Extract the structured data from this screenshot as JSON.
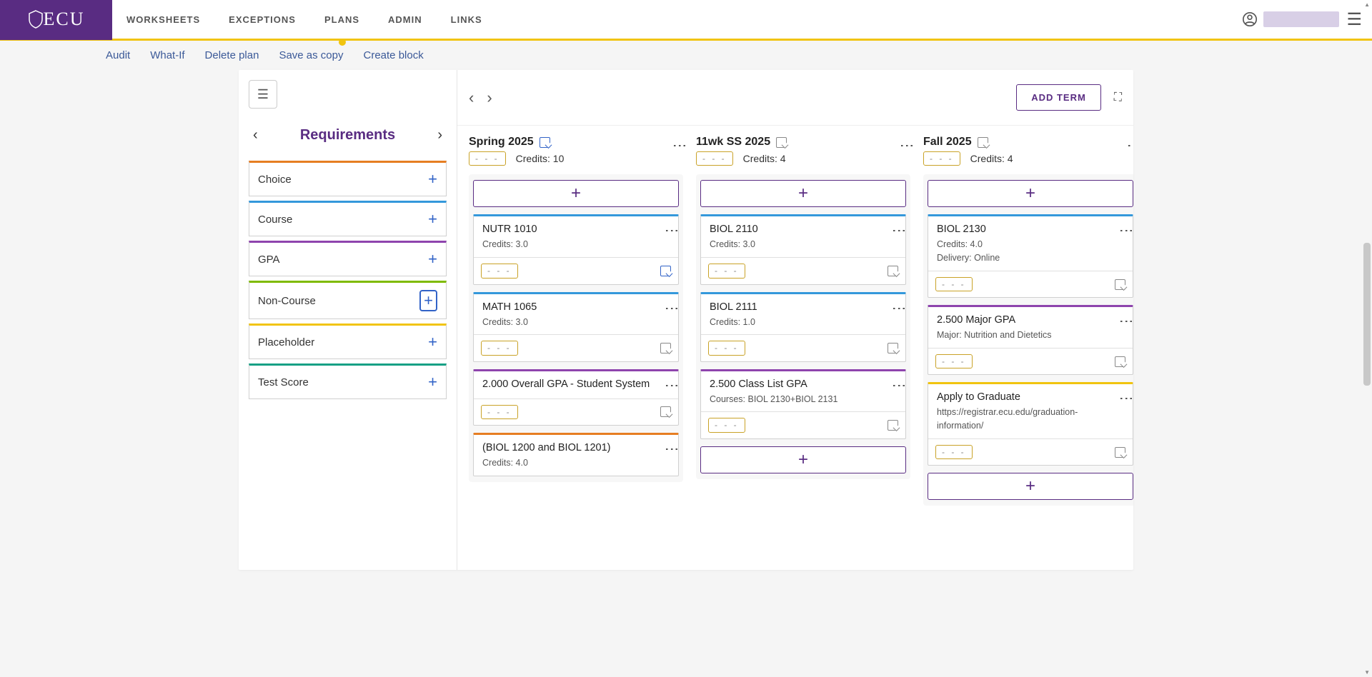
{
  "brand": "ECU",
  "nav": [
    "WORKSHEETS",
    "EXCEPTIONS",
    "PLANS",
    "ADMIN",
    "LINKS"
  ],
  "nav_active_index": 2,
  "subnav": [
    "Audit",
    "What-If",
    "Delete plan",
    "Save as copy",
    "Create block"
  ],
  "sidebar": {
    "title": "Requirements",
    "items": [
      {
        "label": "Choice",
        "color": "#e67e22"
      },
      {
        "label": "Course",
        "color": "#3498db"
      },
      {
        "label": "GPA",
        "color": "#8e44ad"
      },
      {
        "label": "Non-Course",
        "color": "#7fba00",
        "highlight": true
      },
      {
        "label": "Placeholder",
        "color": "#F1C40F"
      },
      {
        "label": "Test Score",
        "color": "#16a085"
      }
    ]
  },
  "add_term_label": "ADD TERM",
  "credits_label": "Credits:",
  "terms": [
    {
      "name": "Spring 2025",
      "note": "blue",
      "credits": "10",
      "cards": [
        {
          "color": "#3498db",
          "title": "NUTR 1010",
          "sub": "Credits: 3.0",
          "note": "blue"
        },
        {
          "color": "#3498db",
          "title": "MATH 1065",
          "sub": "Credits: 3.0",
          "note": "gray"
        },
        {
          "color": "#8e44ad",
          "title": "2.000 Overall GPA - Student System",
          "sub": "",
          "note": "gray"
        },
        {
          "color": "#e67e22",
          "title": "(BIOL 1200 and BIOL 1201)",
          "sub": "Credits: 4.0",
          "no_bottom": true
        }
      ]
    },
    {
      "name": "11wk SS 2025",
      "note": "gray",
      "credits": "4",
      "cards": [
        {
          "color": "#3498db",
          "title": "BIOL 2110",
          "sub": "Credits: 3.0",
          "note": "gray"
        },
        {
          "color": "#3498db",
          "title": "BIOL 2111",
          "sub": "Credits: 1.0",
          "note": "gray"
        },
        {
          "color": "#8e44ad",
          "title": "2.500 Class List GPA",
          "sub": "Courses: BIOL 2130+BIOL 2131",
          "note": "gray"
        }
      ],
      "trailing_add": true
    },
    {
      "name": "Fall 2025",
      "note": "gray",
      "credits": "4",
      "cards": [
        {
          "color": "#3498db",
          "title": "BIOL 2130",
          "sub": "Credits: 4.0\nDelivery: Online",
          "note": "gray"
        },
        {
          "color": "#8e44ad",
          "title": "2.500 Major GPA",
          "sub": "Major: Nutrition and Dietetics",
          "note": "gray"
        },
        {
          "color": "#F1C40F",
          "title": "Apply to Graduate",
          "sub": "https://registrar.ecu.edu/graduation-information/",
          "note": "gray"
        }
      ],
      "trailing_add": true
    }
  ]
}
